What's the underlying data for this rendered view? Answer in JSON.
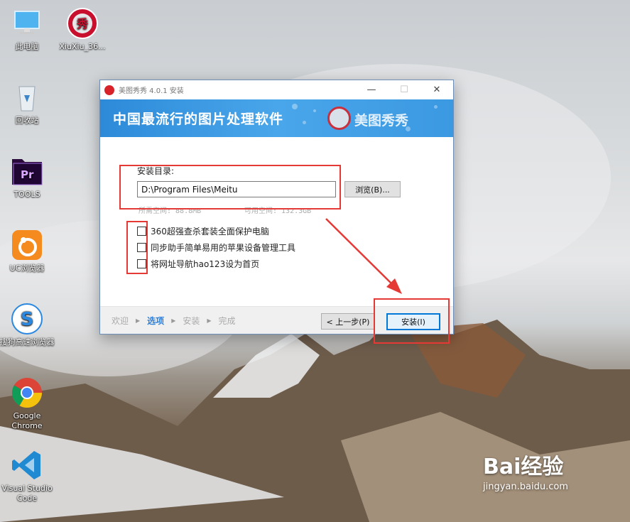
{
  "desktop": {
    "icons": [
      {
        "label": "此电脑",
        "icon": "computer-icon"
      },
      {
        "label": "XiuXiu_36...",
        "icon": "xiuxiu-icon"
      },
      {
        "label": "回收站",
        "icon": "recycle-bin-icon"
      },
      {
        "label": "TOOLS",
        "icon": "premiere-icon"
      },
      {
        "label": "UC浏览器",
        "icon": "uc-browser-icon"
      },
      {
        "label": "搜狗高速浏览器",
        "icon": "sogou-browser-icon"
      },
      {
        "label": "Google Chrome",
        "icon": "chrome-icon"
      },
      {
        "label": "Visual Studio Code",
        "icon": "vscode-icon"
      }
    ]
  },
  "installer": {
    "title": "美图秀秀 4.0.1 安装",
    "banner_slogan": "中国最流行的图片处理软件",
    "banner_brand": "美图秀秀",
    "dir_label": "安装目录:",
    "install_path": "D:\\Program Files\\Meitu",
    "browse_label": "浏览(B)...",
    "required_space": "所需空间: 88.8MB",
    "available_space": "可用空间: 132.3GB",
    "options": [
      {
        "label": "360超强查杀套装全面保护电脑",
        "checked": false
      },
      {
        "label": "同步助手简单易用的苹果设备管理工具",
        "checked": false
      },
      {
        "label": "将网址导航hao123设为首页",
        "checked": false
      }
    ],
    "steps": [
      "欢迎",
      "选项",
      "安装",
      "完成"
    ],
    "active_step": "选项",
    "prev_label": "< 上一步(P)",
    "install_label": "安装(I)"
  },
  "watermark": {
    "brand": "Bai经验",
    "url": "jingyan.baidu.com"
  },
  "colors": {
    "annotation_red": "#e53935",
    "accent_blue": "#2f7fd6",
    "banner_blue": "#3b99e2"
  }
}
